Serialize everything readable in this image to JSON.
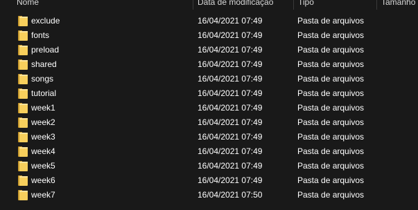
{
  "columns": {
    "name": "Nome",
    "date": "Data de modificação",
    "type": "Tipo",
    "size": "Tamanho"
  },
  "rows": [
    {
      "name": "exclude",
      "date": "16/04/2021 07:49",
      "type": "Pasta de arquivos"
    },
    {
      "name": "fonts",
      "date": "16/04/2021 07:49",
      "type": "Pasta de arquivos"
    },
    {
      "name": "preload",
      "date": "16/04/2021 07:49",
      "type": "Pasta de arquivos"
    },
    {
      "name": "shared",
      "date": "16/04/2021 07:49",
      "type": "Pasta de arquivos"
    },
    {
      "name": "songs",
      "date": "16/04/2021 07:49",
      "type": "Pasta de arquivos"
    },
    {
      "name": "tutorial",
      "date": "16/04/2021 07:49",
      "type": "Pasta de arquivos"
    },
    {
      "name": "week1",
      "date": "16/04/2021 07:49",
      "type": "Pasta de arquivos"
    },
    {
      "name": "week2",
      "date": "16/04/2021 07:49",
      "type": "Pasta de arquivos"
    },
    {
      "name": "week3",
      "date": "16/04/2021 07:49",
      "type": "Pasta de arquivos"
    },
    {
      "name": "week4",
      "date": "16/04/2021 07:49",
      "type": "Pasta de arquivos"
    },
    {
      "name": "week5",
      "date": "16/04/2021 07:49",
      "type": "Pasta de arquivos"
    },
    {
      "name": "week6",
      "date": "16/04/2021 07:49",
      "type": "Pasta de arquivos"
    },
    {
      "name": "week7",
      "date": "16/04/2021 07:50",
      "type": "Pasta de arquivos"
    }
  ],
  "icons": {
    "folder": "folder-icon"
  },
  "colors": {
    "background": "#191919",
    "folder_front": "#f7cf5c",
    "folder_back": "#c89a2f",
    "text": "#ffffff"
  }
}
